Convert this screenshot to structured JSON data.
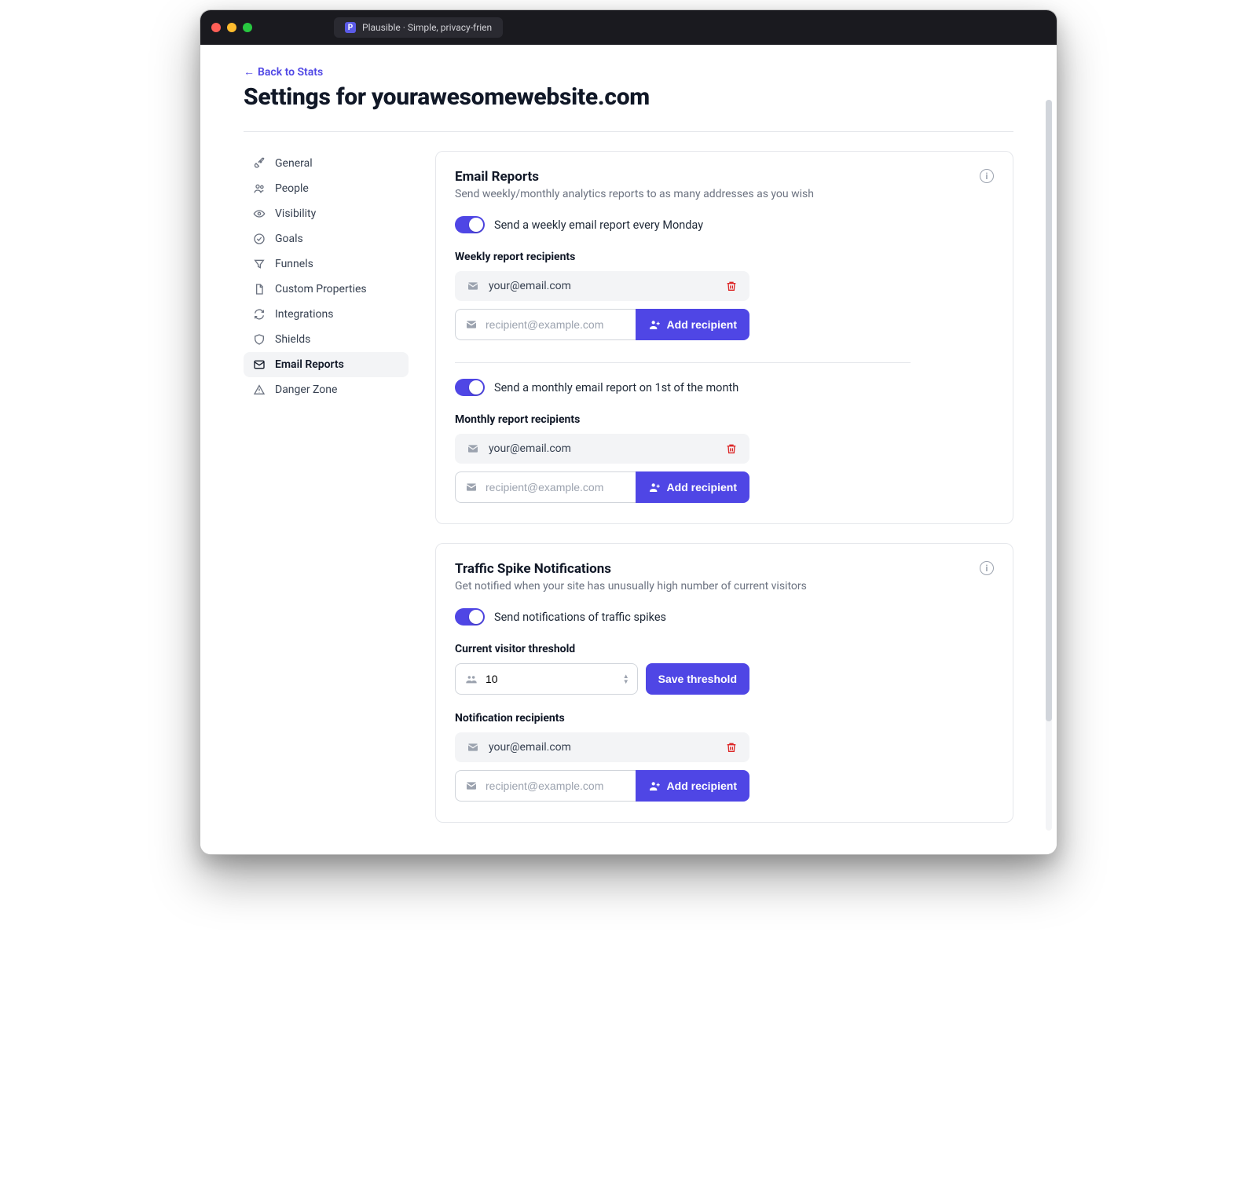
{
  "browser": {
    "tab_title": "Plausible · Simple, privacy-frien"
  },
  "header": {
    "back_label": "Back to Stats",
    "page_title": "Settings for yourawesomewebsite.com"
  },
  "sidebar": {
    "items": [
      {
        "label": "General",
        "icon": "rocket-icon"
      },
      {
        "label": "People",
        "icon": "users-icon"
      },
      {
        "label": "Visibility",
        "icon": "eye-icon"
      },
      {
        "label": "Goals",
        "icon": "check-circle-icon"
      },
      {
        "label": "Funnels",
        "icon": "funnel-icon"
      },
      {
        "label": "Custom Properties",
        "icon": "document-icon"
      },
      {
        "label": "Integrations",
        "icon": "refresh-icon"
      },
      {
        "label": "Shields",
        "icon": "shield-icon"
      },
      {
        "label": "Email Reports",
        "icon": "mail-icon",
        "active": true
      },
      {
        "label": "Danger Zone",
        "icon": "warning-icon"
      }
    ]
  },
  "email_reports": {
    "title": "Email Reports",
    "subtitle": "Send weekly/monthly analytics reports to as many addresses as you wish",
    "weekly": {
      "toggle_label": "Send a weekly email report every Monday",
      "recipients_label": "Weekly report recipients",
      "recipient": "your@email.com",
      "placeholder": "recipient@example.com",
      "add_label": "Add recipient"
    },
    "monthly": {
      "toggle_label": "Send a monthly email report on 1st of the month",
      "recipients_label": "Monthly report recipients",
      "recipient": "your@email.com",
      "placeholder": "recipient@example.com",
      "add_label": "Add recipient"
    }
  },
  "traffic_spike": {
    "title": "Traffic Spike Notifications",
    "subtitle": "Get notified when your site has unusually high number of current visitors",
    "toggle_label": "Send notifications of traffic spikes",
    "threshold_label": "Current visitor threshold",
    "threshold_value": "10",
    "save_label": "Save threshold",
    "recipients_label": "Notification recipients",
    "recipient": "your@email.com",
    "placeholder": "recipient@example.com",
    "add_label": "Add recipient"
  }
}
